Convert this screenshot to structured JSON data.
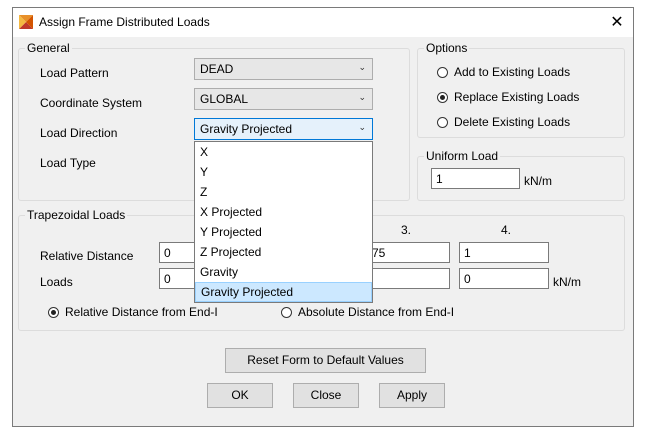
{
  "window": {
    "title": "Assign Frame Distributed Loads",
    "close_glyph": "✕",
    "icon": "app-icon"
  },
  "general": {
    "legend": "General",
    "load_pattern_label": "Load Pattern",
    "load_pattern_value": "DEAD",
    "coord_system_label": "Coordinate System",
    "coord_system_value": "GLOBAL",
    "load_direction_label": "Load Direction",
    "load_direction_value": "Gravity Projected",
    "load_type_label": "Load Type"
  },
  "direction_options": [
    "X",
    "Y",
    "Z",
    "X Projected",
    "Y Projected",
    "Z Projected",
    "Gravity",
    "Gravity Projected"
  ],
  "direction_selected_index": 7,
  "options": {
    "legend": "Options",
    "items": [
      "Add to Existing Loads",
      "Replace Existing Loads",
      "Delete Existing Loads"
    ],
    "selected_index": 1
  },
  "uniform": {
    "legend": "Uniform Load",
    "value": "1",
    "unit": "kN/m"
  },
  "trapezoidal": {
    "legend": "Trapezoidal Loads",
    "col3": "3.",
    "col4": "4.",
    "rel_dist_label": "Relative Distance",
    "loads_label": "Loads",
    "rel_dist_values": [
      "0",
      "75",
      "1"
    ],
    "load_values": [
      "0",
      "0"
    ],
    "unit": "kN/m",
    "radio_relative": "Relative Distance from End-I",
    "radio_absolute": "Absolute Distance from End-I",
    "selected": "relative"
  },
  "buttons": {
    "reset": "Reset Form to Default Values",
    "ok": "OK",
    "close": "Close",
    "apply": "Apply"
  }
}
